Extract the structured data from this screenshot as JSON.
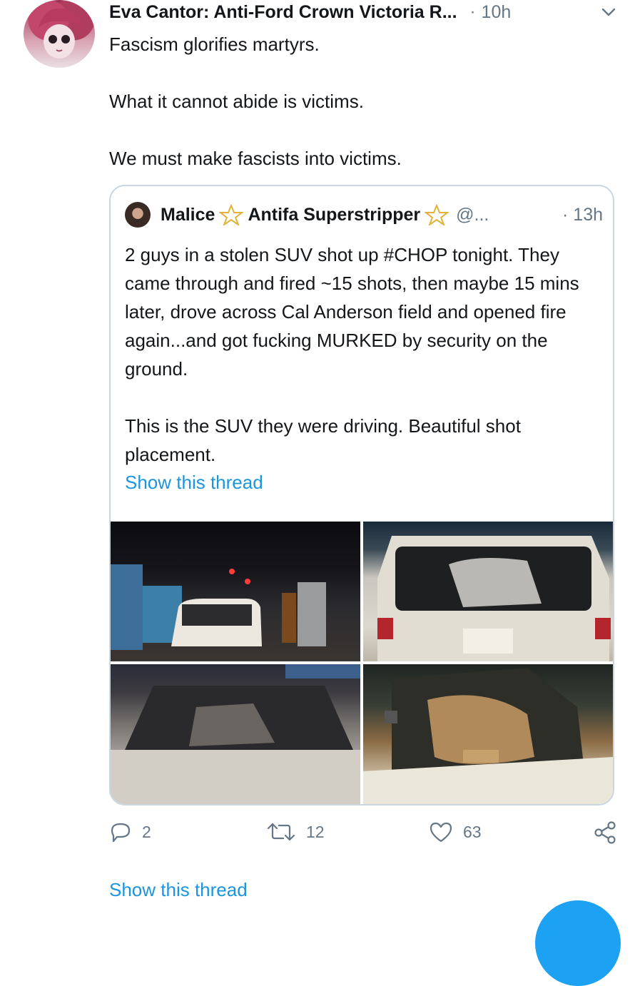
{
  "tweet": {
    "author_name": "Eva Cantor: Anti-Ford Crown Victoria R...",
    "separator": "·",
    "time": "10h",
    "text": "Fascism glorifies martyrs.\n\nWhat it cannot abide is victims.\n\nWe must make fascists into victims."
  },
  "quoted_tweet": {
    "name_part1": "Malice",
    "name_part2": "Antifa Superstripper",
    "handle": "@...",
    "time": "· 13h",
    "text": "2 guys in a stolen SUV shot up #CHOP tonight. They came through and fired ~15 shots, then maybe 15 mins later, drove across Cal Anderson field and opened fire again...and got fucking MURKED by security on the ground.\n\nThis is the SUV they were driving. Beautiful shot placement.",
    "show_thread": "Show this thread",
    "photos": [
      "suv-night-street-photo",
      "suv-rear-window-photo",
      "suv-windshield-photo",
      "suv-side-window-photo"
    ]
  },
  "actions": {
    "reply_count": "2",
    "retweet_count": "12",
    "like_count": "63",
    "share_icon": "share-icon"
  },
  "footer": {
    "show_thread": "Show this thread"
  },
  "colors": {
    "link": "#1b95e0",
    "muted": "#657786",
    "border": "#c9d6e0",
    "accent": "#1da1f2"
  }
}
